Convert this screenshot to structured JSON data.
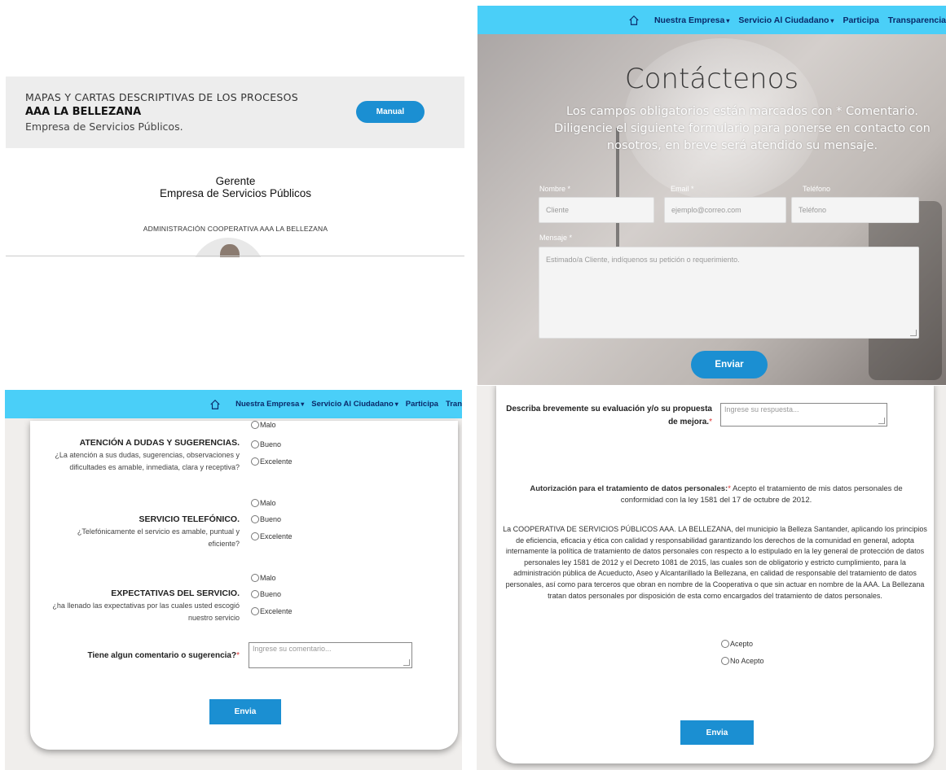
{
  "panel1": {
    "banner": {
      "line1": "MAPAS Y CARTAS DESCRIPTIVAS DE LOS PROCESOS",
      "line2": "AAA LA BELLEZANA",
      "line3": "Empresa de Servicios Públicos.",
      "button": "Manual"
    },
    "gerente_title": "Gerente",
    "gerente_subtitle": "Empresa de Servicios Públicos",
    "admin": "ADMINISTRACIÓN COOPERATIVA AAA LA BELLEZANA"
  },
  "nav": {
    "items": [
      "Nuestra Empresa",
      "Servicio Al Ciudadano",
      "Participa",
      "Transparencia"
    ],
    "items_short": [
      "Nuestra Empresa",
      "Servicio Al Ciudadano",
      "Participa",
      "Tran"
    ]
  },
  "contact": {
    "title": "Contáctenos",
    "subtitle": "Los campos obligatorios están marcados con * Comentario. Diligencie el siguiente formulario para ponerse en contacto con nosotros, en breve será atendido su mensaje.",
    "fields": [
      {
        "label": "Nombre *",
        "placeholder": "Cliente"
      },
      {
        "label": "Email *",
        "placeholder": "ejemplo@correo.com"
      },
      {
        "label": "Teléfono",
        "placeholder": "Teléfono"
      }
    ],
    "message_label": "Mensaje *",
    "message_placeholder": "Estimado/a Cliente, indíquenos su petición o requerimiento.",
    "submit": "Enviar"
  },
  "survey": {
    "questions": [
      {
        "title": "ATENCIÓN A DUDAS Y SUGERENCIAS.",
        "desc": "¿La atención a sus dudas, sugerencias, observaciones y dificultades es amable, inmediata, clara y receptiva?"
      },
      {
        "title": "SERVICIO TELEFÓNICO.",
        "desc": "¿Telefónicamente el servicio es amable, puntual y eficiente?"
      },
      {
        "title": "EXPECTATIVAS DEL SERVICIO.",
        "desc": "¿ha llenado las expectativas por las cuales usted escogió nuestro servicio"
      }
    ],
    "options": [
      "Malo",
      "Bueno",
      "Excelente"
    ],
    "comment_label": "Tiene algun comentario o sugerencia?",
    "comment_placeholder": "Ingrese su comentario...",
    "required_mark": "*",
    "submit": "Envia"
  },
  "consent": {
    "eval_label": "Describa brevemente su evaluación y/o su propuesta de mejora.",
    "eval_placeholder": "Ingrese su respuesta...",
    "auth_label": "Autorización para el tratamiento de datos personales:",
    "auth_text": "Acepto el tratamiento de mis datos personales de conformidad con la ley 1581 del 17 de octubre de 2012.",
    "policy": "La COOPERATIVA DE SERVICIOS PÚBLICOS AAA. LA BELLEZANA, del municipio la Belleza Santander, aplicando los principios de eficiencia, eficacia y ética con calidad y responsabilidad garantizando los derechos de la comunidad en general, adopta internamente la política de tratamiento de datos personales con respecto a lo estipulado en la ley general de protección de datos personales ley 1581 de 2012 y el Decreto 1081 de 2015, las cuales son de obligatorio y estricto cumplimiento, para la administración pública de Acueducto, Aseo y Alcantarillado la Bellezana, en calidad de responsable del tratamiento de datos personales, así como para terceros que obran en nombre de la Cooperativa o que sin actuar en nombre de la AAA. La Bellezana tratan datos personales por disposición de esta como encargados del tratamiento de datos personales.",
    "options": [
      "Acepto",
      "No Acepto"
    ],
    "submit": "Envia"
  },
  "colors": {
    "navbar": "#4acff8",
    "button": "#1b8fd2",
    "nav_text": "#0a2a6a",
    "required": "#d33333"
  }
}
